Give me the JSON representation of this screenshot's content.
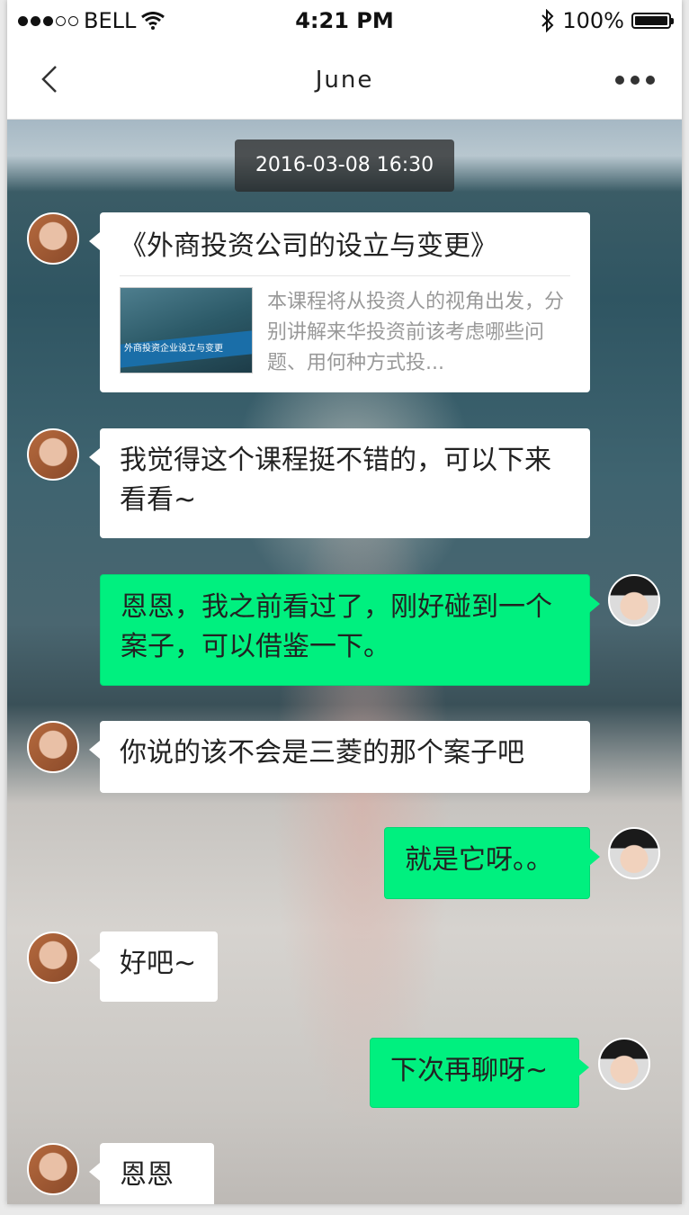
{
  "status": {
    "carrier": "BELL",
    "time": "4:21 PM",
    "battery": "100%"
  },
  "nav": {
    "title": "June"
  },
  "chat": {
    "timestamp": "2016-03-08  16:30",
    "card": {
      "title": "《外商投资公司的设立与变更》",
      "thumb_text": "外商投资企业设立与变更",
      "description": "本课程将从投资人的视角出发，分别讲解来华投资前该考虑哪些问题、用何种方式投..."
    },
    "messages": [
      {
        "from": "her",
        "text": "我觉得这个课程挺不错的，可以下来看看~"
      },
      {
        "from": "me",
        "text": "恩恩，我之前看过了，刚好碰到一个案子，可以借鉴一下。"
      },
      {
        "from": "her",
        "text": "你说的该不会是三菱的那个案子吧"
      },
      {
        "from": "me",
        "text": "就是它呀。。"
      },
      {
        "from": "her",
        "text": "好吧~"
      },
      {
        "from": "me",
        "text": "下次再聊呀~"
      },
      {
        "from": "her",
        "text": "恩恩~"
      }
    ]
  },
  "colors": {
    "outgoing_bubble": "#00f07f",
    "incoming_bubble": "#ffffff"
  }
}
